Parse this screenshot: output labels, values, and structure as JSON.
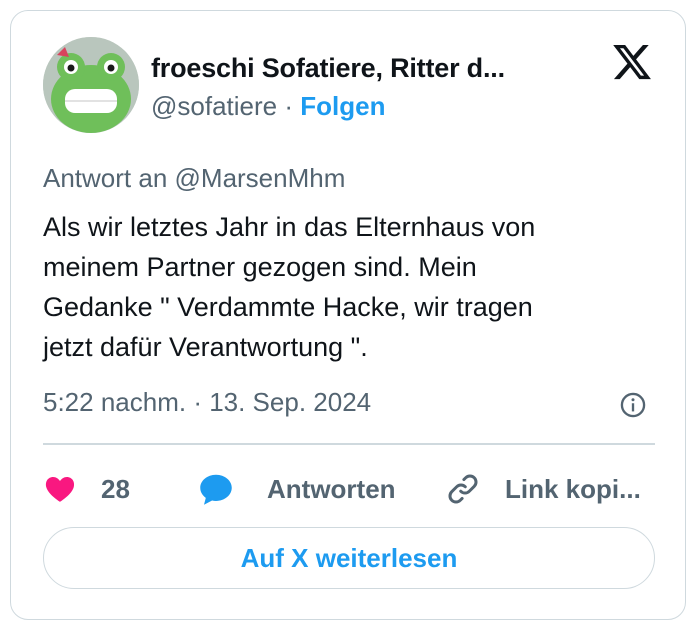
{
  "author": {
    "display_name": "froeschi Sofatiere, Ritter d...",
    "handle": "@sofatiere",
    "separator": "·",
    "follow_label": "Folgen",
    "avatar_icon": "frog-avatar"
  },
  "brand": {
    "logo_icon": "x-logo-icon"
  },
  "tweet": {
    "reply_to": "Antwort an @MarsenMhm",
    "lines": [
      "Als wir letztes Jahr in das Elternhaus von",
      "meinem Partner gezogen sind. Mein",
      "Gedanke \" Verdammte Hacke, wir tragen",
      "jetzt dafür Verantwortung \"."
    ],
    "timestamp": "5:22 nachm. · 13. Sep. 2024"
  },
  "actions": {
    "like_count": "28",
    "reply_label": "Antworten",
    "copy_link_label": "Link kopi..."
  },
  "read_more_label": "Auf X weiterlesen",
  "colors": {
    "accent": "#1d9bf0",
    "like": "#f91880",
    "muted": "#536471",
    "border": "#cfd9de"
  }
}
